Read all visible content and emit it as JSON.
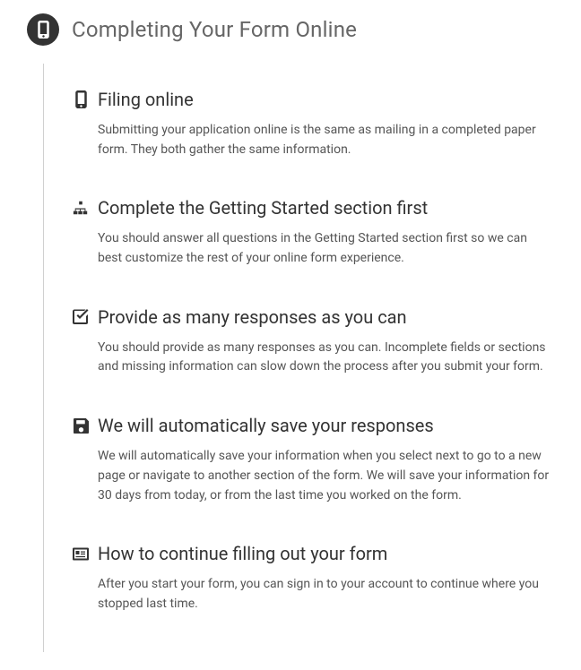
{
  "page": {
    "title": "Completing Your Form Online"
  },
  "sections": [
    {
      "title": "Filing online",
      "body": "Submitting your application online is the same as mailing in a completed paper form. They both gather the same information."
    },
    {
      "title": "Complete the Getting Started section first",
      "body": "You should answer all questions in the Getting Started section first so we can best customize the rest of your online form experience."
    },
    {
      "title": "Provide as many responses as you can",
      "body": "You should provide as many responses as you can. Incomplete fields or sections and missing information can slow down the process after you submit your form."
    },
    {
      "title": "We will automatically save your responses",
      "body": "We will automatically save your information when you select next to go to a new page or navigate to another section of the form. We will save your information for 30 days from today, or from the last time you worked on the form."
    },
    {
      "title": "How to continue filling out your form",
      "body": "After you start your form, you can sign in to your account to continue where you stopped last time."
    }
  ]
}
